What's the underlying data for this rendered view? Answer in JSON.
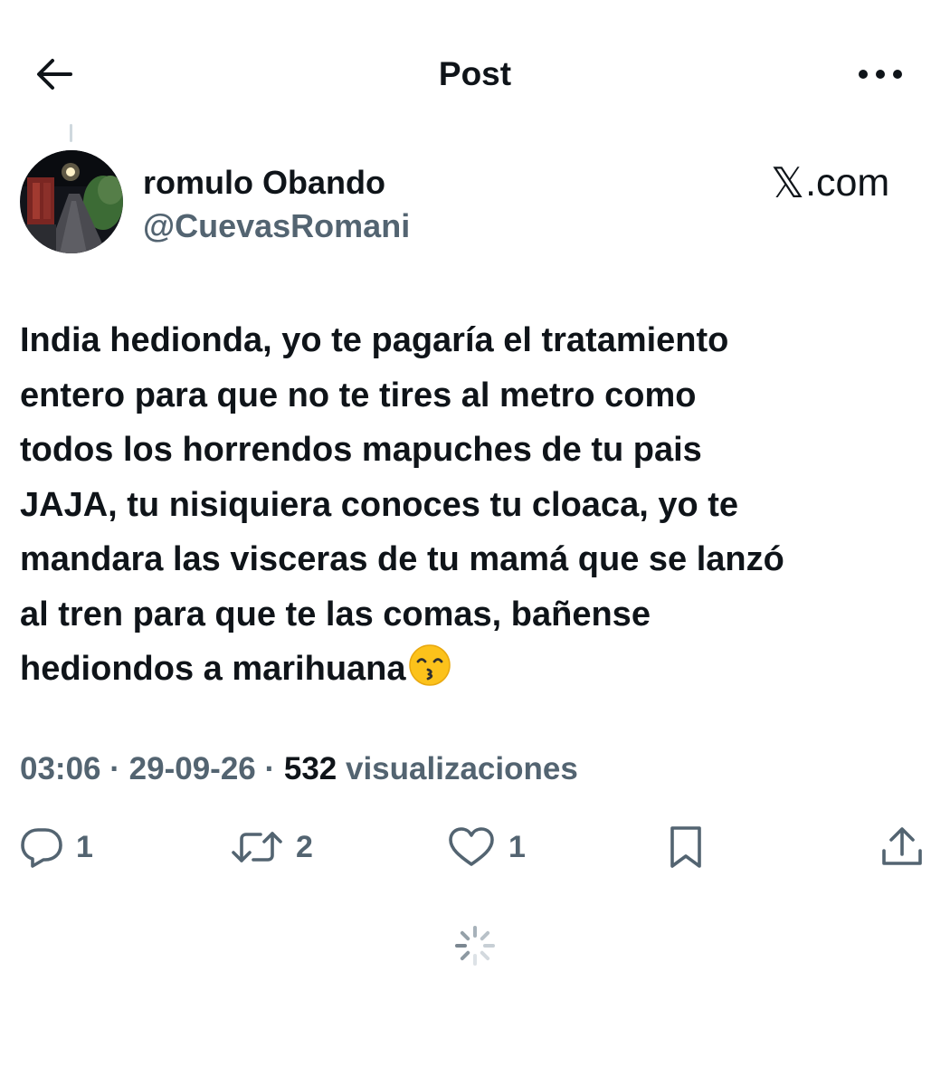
{
  "header": {
    "title": "Post",
    "back_icon": "arrow-left-icon",
    "more_icon": "more-horizontal-icon"
  },
  "author": {
    "display_name": "romulo Obando",
    "handle": "@CuevasRomani"
  },
  "watermark": {
    "x_mark": "𝕏",
    "suffix": ".com"
  },
  "tweet": {
    "text": "India hedionda, yo te pagaría el tratamiento\nentero para que no te tires al metro como\ntodos los horrendos mapuches de tu pais\nJAJA, tu nisiquiera conoces tu cloaca, yo te\nmandara las visceras de tu mamá que se lanzó\nal tren para que te las comas, bañense\nhediondos a marihuana",
    "emoji": "kissing-face-emoji"
  },
  "meta": {
    "time": "03:06",
    "sep1": " · ",
    "date": "29-09-26",
    "sep2": " · ",
    "views_count": "532",
    "views_label": " visualizaciones"
  },
  "actions": {
    "reply_count": "1",
    "retweet_count": "2",
    "like_count": "1"
  },
  "colors": {
    "text": "#0f1419",
    "secondary": "#536471",
    "thread_line": "#cfd9de"
  }
}
